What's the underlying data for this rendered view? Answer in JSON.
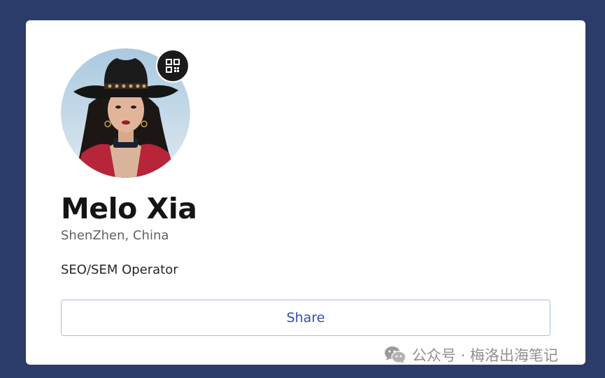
{
  "profile": {
    "name": "Melo Xia",
    "location": "ShenZhen, China",
    "bio": "SEO/SEM Operator",
    "avatar_icon": "profile-photo",
    "qr_icon": "qr-code-icon"
  },
  "actions": {
    "share_label": "Share"
  },
  "watermark": {
    "icon": "wechat-icon",
    "text": "公众号 · 梅洛出海笔记"
  },
  "colors": {
    "background": "#2b3c6b",
    "card": "#ffffff",
    "share_text": "#2c4fb0",
    "share_border": "#a9bedb"
  }
}
